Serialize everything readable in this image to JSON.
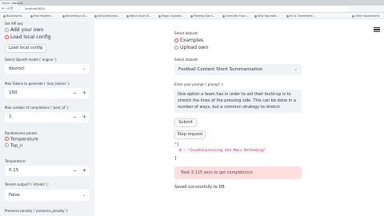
{
  "browser": {
    "tab_title": "Home - Streamlit",
    "url": "localhost:8501",
    "bookmarks": [
      "Bookmarks",
      "Post Modern...",
      "Becoming a D...",
      "deSolveScript...",
      "Wave Chart B...",
      "Magic Quadra...",
      "Plotting Dat t...",
      "Scientific Foun...",
      "Why Kaumbh...",
      "It's a Timeframe...",
      "Other bookmarks"
    ]
  },
  "sidebar": {
    "top_label": "Set API key:",
    "config_options": [
      {
        "label": "Add your own",
        "selected": false
      },
      {
        "label": "Load local config",
        "selected": true
      }
    ],
    "load_button": "Load local config",
    "engine_label": "Select OpenAI model (`engine`):",
    "engine_value": "davinci",
    "max_tokens_label": "Max Tokens to generate (`max_tokens`):",
    "max_tokens_value": "150",
    "best_of_label": "Max number of completions (`best_of`):",
    "best_of_value": "1",
    "randomness_label": "Randomness param:",
    "randomness_options": [
      {
        "label": "Temperature",
        "selected": true
      },
      {
        "label": "Top_n",
        "selected": false
      }
    ],
    "temperature_label": "Temperature:",
    "temperature_value": "0.15",
    "stream_label": "Stream output? (`stream`):",
    "stream_value": "False",
    "presence_label": "Presence penalty (`presence_penalty`):",
    "minus": "−",
    "plus": "+",
    "chevron": "⌄"
  },
  "main": {
    "dataset_label": "Select dataset:",
    "dataset_options": [
      {
        "label": "Examples",
        "selected": true
      },
      {
        "label": "Upload own",
        "selected": false
      }
    ],
    "example_label": "Select dataset:",
    "example_value": "Football Content Short Summarization",
    "prompt_label": "Enter your prompt (`prompt`):",
    "prompt_lines": [
      "One option a team has in order to aid their build-up is to",
      "stretch the lines of the pressing side. This can be done in a",
      "number of ways, but a common strategy to stretch"
    ],
    "submit_button": "Submit",
    "stop_button": "Stop request",
    "json_open": "\"[",
    "json_entry": "0 : \"Counterpressing and Mass Defending\"",
    "json_close": "]",
    "error_text": "Took 3.115 secs to get completion/s",
    "saved_text": "Saved successfully to DB"
  },
  "colors": {
    "accent": "#ff4b4b",
    "sidebar_bg": "#f0f2f6",
    "error_bg": "#ffdede",
    "error_text": "#7d353b"
  }
}
